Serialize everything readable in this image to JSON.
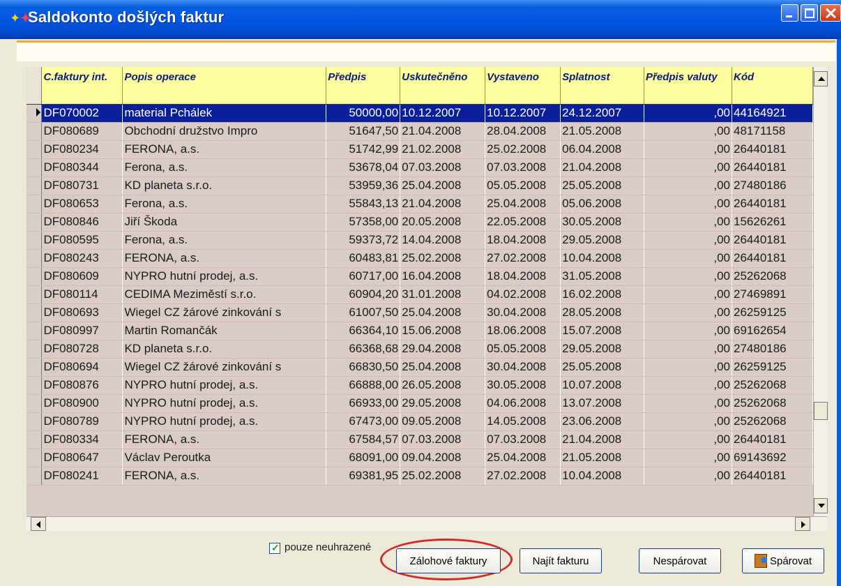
{
  "window": {
    "title": "Saldokonto došlých faktur"
  },
  "grid": {
    "columns": [
      "C.faktury int.",
      "Popis operace",
      "Předpis",
      "Uskutečněno",
      "Vystaveno",
      "Splatnost",
      "Předpis valuty",
      "Kód"
    ],
    "rows": [
      [
        "DF070002",
        "material Pchálek",
        "50000,00",
        "10.12.2007",
        "10.12.2007",
        "24.12.2007",
        ",00",
        "44164921"
      ],
      [
        "DF080689",
        "Obchodní družstvo Impro",
        "51647,50",
        "21.04.2008",
        "28.04.2008",
        "21.05.2008",
        ",00",
        "48171158"
      ],
      [
        "DF080234",
        "FERONA, a.s.",
        "51742,99",
        "21.02.2008",
        "25.02.2008",
        "06.04.2008",
        ",00",
        "26440181"
      ],
      [
        "DF080344",
        "Ferona, a.s.",
        "53678,04",
        "07.03.2008",
        "07.03.2008",
        "21.04.2008",
        ",00",
        "26440181"
      ],
      [
        "DF080731",
        "KD planeta s.r.o.",
        "53959,36",
        "25.04.2008",
        "05.05.2008",
        "25.05.2008",
        ",00",
        "27480186"
      ],
      [
        "DF080653",
        "Ferona, a.s.",
        "55843,13",
        "21.04.2008",
        "25.04.2008",
        "05.06.2008",
        ",00",
        "26440181"
      ],
      [
        "DF080846",
        "Jiří Škoda",
        "57358,00",
        "20.05.2008",
        "22.05.2008",
        "30.05.2008",
        ",00",
        "15626261"
      ],
      [
        "DF080595",
        "Ferona, a.s.",
        "59373,72",
        "14.04.2008",
        "18.04.2008",
        "29.05.2008",
        ",00",
        "26440181"
      ],
      [
        "DF080243",
        "FERONA, a.s.",
        "60483,81",
        "25.02.2008",
        "27.02.2008",
        "10.04.2008",
        ",00",
        "26440181"
      ],
      [
        "DF080609",
        "NYPRO hutní prodej, a.s.",
        "60717,00",
        "16.04.2008",
        "18.04.2008",
        "31.05.2008",
        ",00",
        "25262068"
      ],
      [
        "DF080114",
        "CEDIMA Meziměstí s.r.o.",
        "60904,20",
        "31.01.2008",
        "04.02.2008",
        "16.02.2008",
        ",00",
        "27469891"
      ],
      [
        "DF080693",
        "Wiegel CZ žárové zinkování s",
        "61007,50",
        "25.04.2008",
        "30.04.2008",
        "28.05.2008",
        ",00",
        "26259125"
      ],
      [
        "DF080997",
        "Martin Romančák",
        "66364,10",
        "15.06.2008",
        "18.06.2008",
        "15.07.2008",
        ",00",
        "69162654"
      ],
      [
        "DF080728",
        "KD planeta s.r.o.",
        "66368,68",
        "29.04.2008",
        "05.05.2008",
        "29.05.2008",
        ",00",
        "27480186"
      ],
      [
        "DF080694",
        "Wiegel CZ žárové zinkování s",
        "66830,50",
        "25.04.2008",
        "30.04.2008",
        "25.05.2008",
        ",00",
        "26259125"
      ],
      [
        "DF080876",
        "NYPRO hutní prodej, a.s.",
        "66888,00",
        "26.05.2008",
        "30.05.2008",
        "10.07.2008",
        ",00",
        "25262068"
      ],
      [
        "DF080900",
        "NYPRO hutní prodej, a.s.",
        "66933,00",
        "29.05.2008",
        "04.06.2008",
        "13.07.2008",
        ",00",
        "25262068"
      ],
      [
        "DF080789",
        "NYPRO hutní prodej, a.s.",
        "67473,00",
        "09.05.2008",
        "14.05.2008",
        "23.06.2008",
        ",00",
        "25262068"
      ],
      [
        "DF080334",
        "FERONA, a.s.",
        "67584,57",
        "07.03.2008",
        "07.03.2008",
        "21.04.2008",
        ",00",
        "26440181"
      ],
      [
        "DF080647",
        "Václav Peroutka",
        "68091,00",
        "09.04.2008",
        "25.04.2008",
        "21.05.2008",
        ",00",
        "69143692"
      ],
      [
        "DF080241",
        "FERONA, a.s.",
        "69381,95",
        "25.02.2008",
        "27.02.2008",
        "10.04.2008",
        ",00",
        "26440181"
      ]
    ],
    "selected_row": 0
  },
  "controls": {
    "checkbox_label": "pouze neuhrazené",
    "checkbox_checked": true,
    "btn_zalohove": "Zálohové faktury",
    "btn_najit": "Najít fakturu",
    "btn_nesparovat": "Nespárovat",
    "btn_sparovat": "Spárovat"
  },
  "colors": {
    "header_bg": "#fdfc9f",
    "row_bg": "#d9ccc5",
    "selected_bg": "#0b1f9c",
    "highlight": "#d12a2a"
  }
}
